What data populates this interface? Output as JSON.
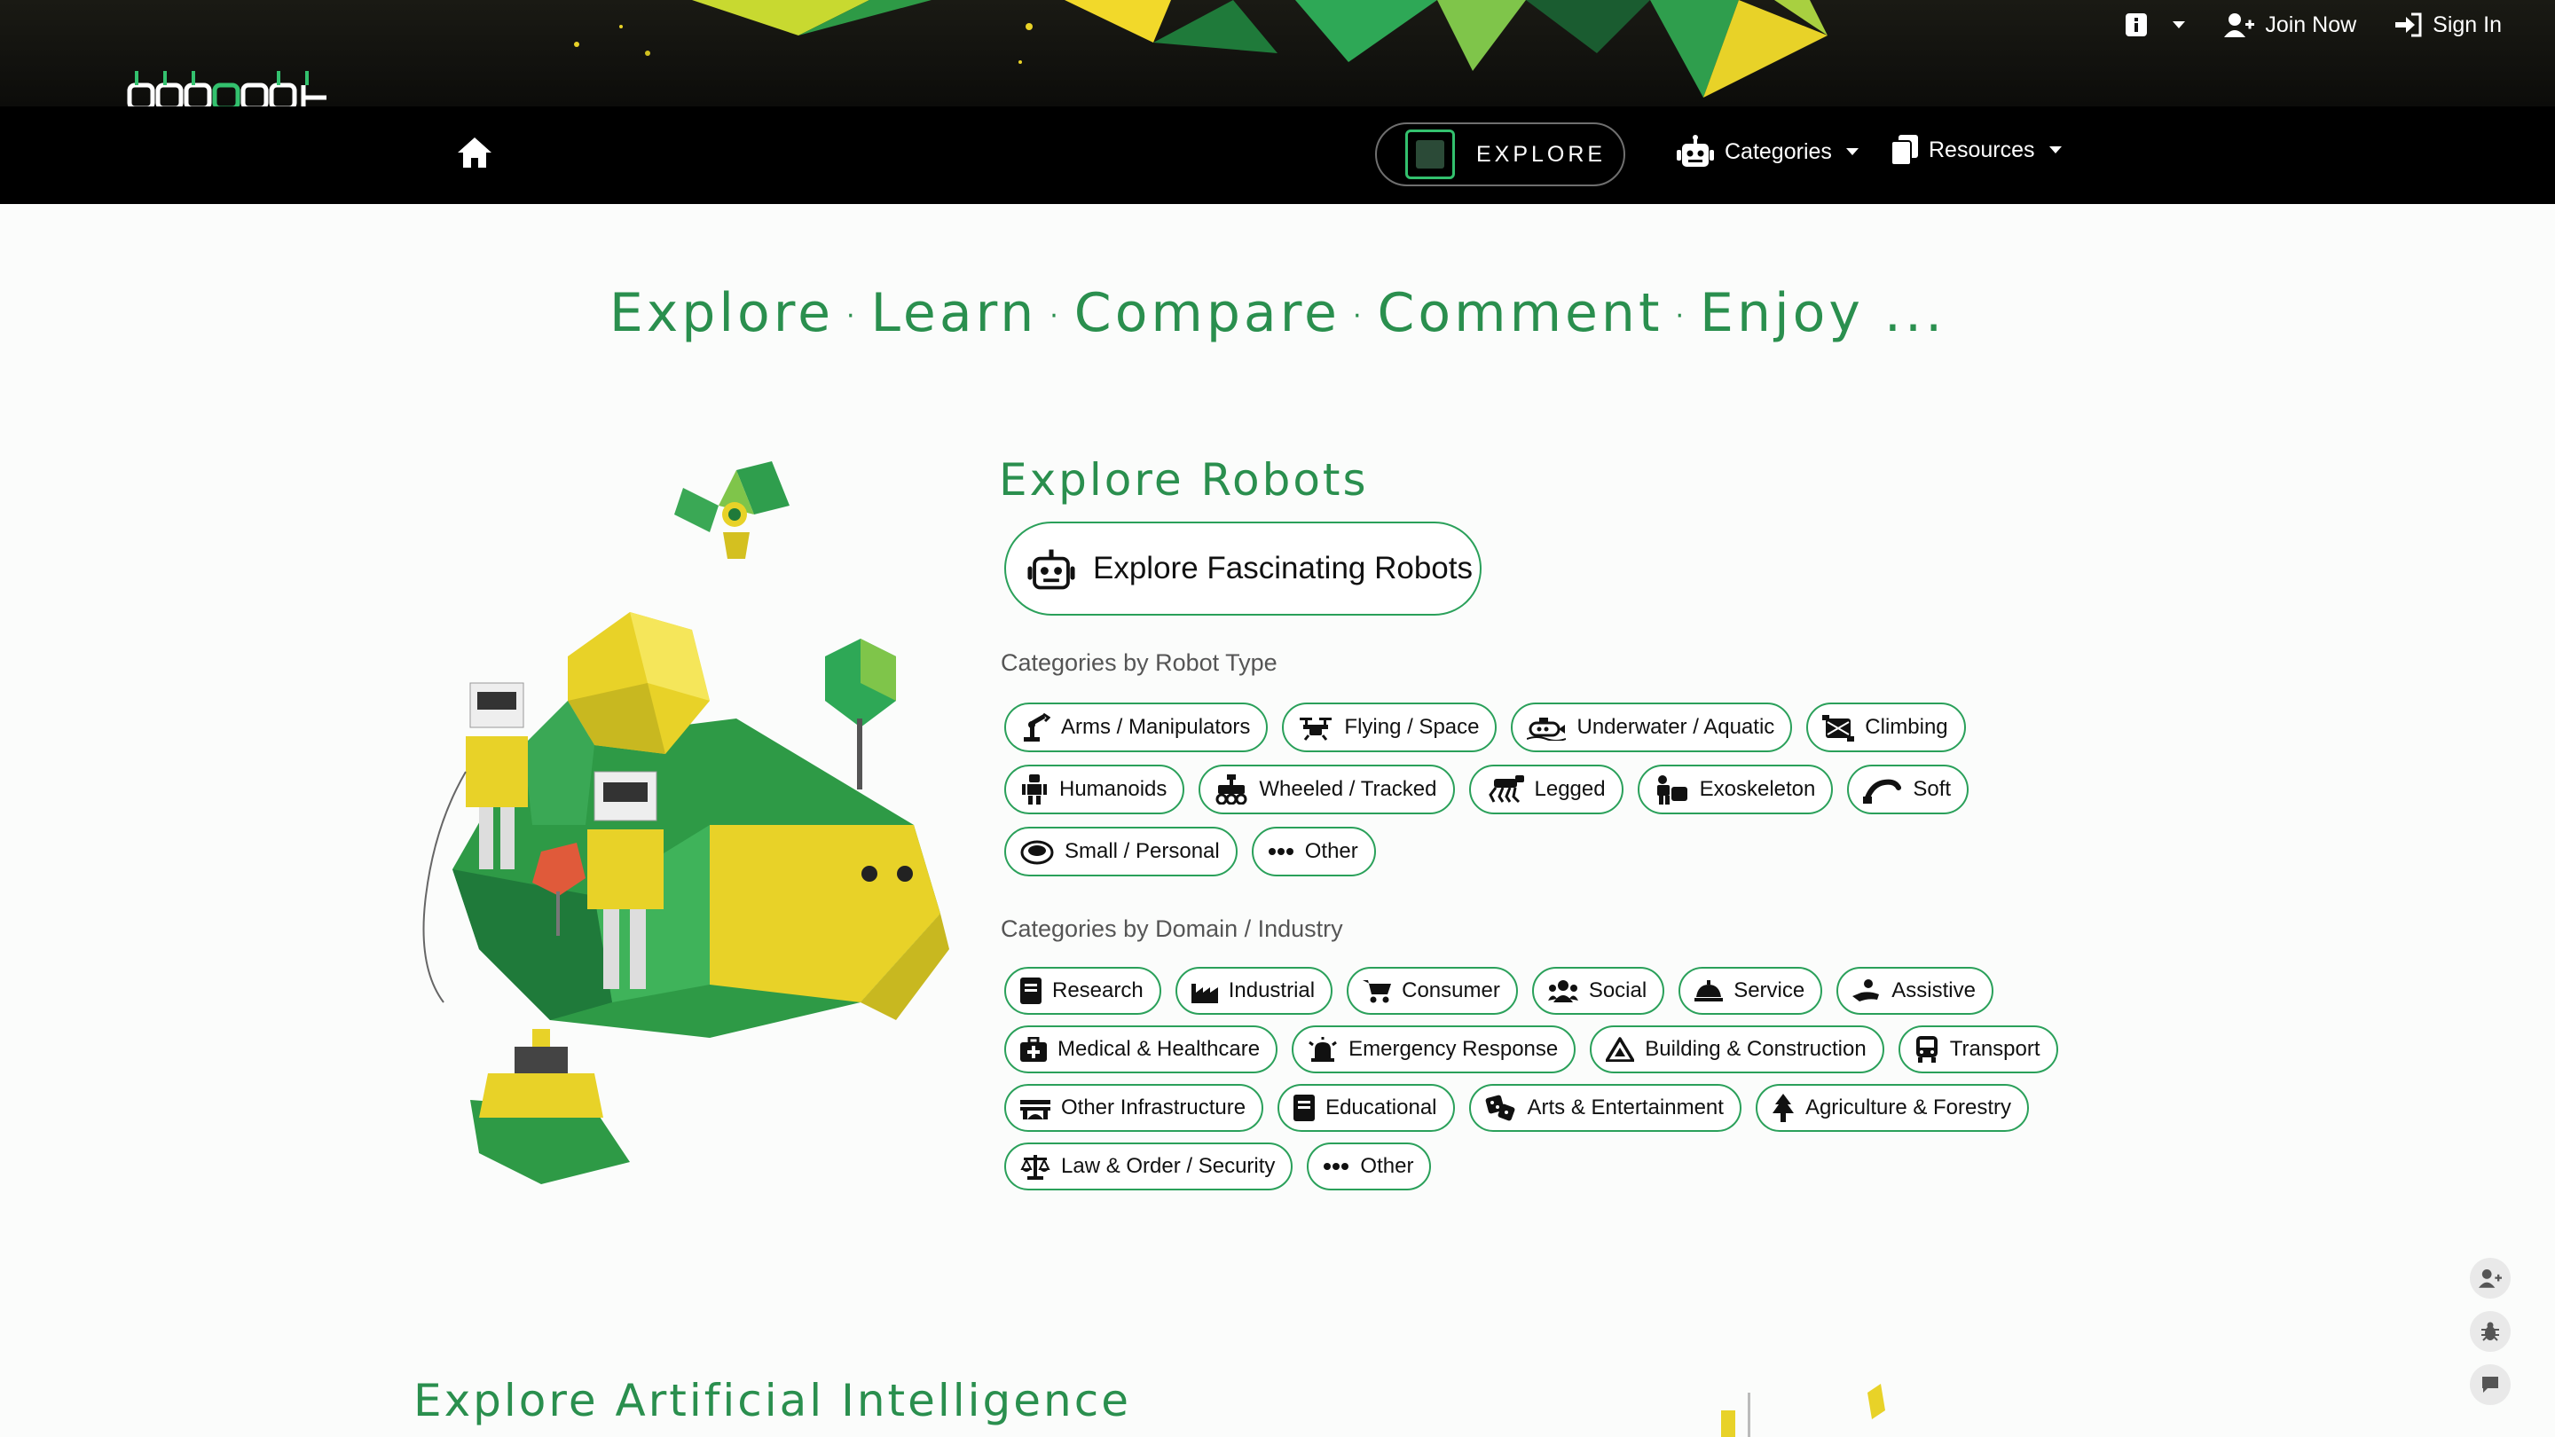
{
  "top_links": {
    "info_label": "",
    "join_label": "Join Now",
    "signin_label": "Sign In"
  },
  "logo": {
    "text": "roboroot"
  },
  "nav": {
    "explore_label": "EXPLORE",
    "categories_label": "Categories",
    "resources_label": "Resources"
  },
  "hero": {
    "tagline": [
      "Explore",
      "Learn",
      "Compare",
      "Comment",
      "Enjoy ..."
    ]
  },
  "explore_robots": {
    "title": "Explore Robots",
    "button_label": "Explore Fascinating Robots",
    "robot_type_heading": "Categories by Robot Type",
    "robot_types": [
      [
        "Arms / Manipulators",
        "Flying / Space",
        "Underwater / Aquatic",
        "Climbing"
      ],
      [
        "Humanoids",
        "Wheeled / Tracked",
        "Legged",
        "Exoskeleton",
        "Soft"
      ],
      [
        "Small / Personal",
        "Other"
      ]
    ],
    "domain_heading": "Categories by Domain / Industry",
    "domains": [
      [
        "Research",
        "Industrial",
        "Consumer",
        "Social",
        "Service",
        "Assistive"
      ],
      [
        "Medical & Healthcare",
        "Emergency Response",
        "Building & Construction",
        "Transport"
      ],
      [
        "Other Infrastructure",
        "Educational",
        "Arts & Entertainment",
        "Agriculture & Forestry"
      ],
      [
        "Law & Order / Security",
        "Other"
      ]
    ]
  },
  "explore_ai": {
    "title": "Explore Artificial Intelligence"
  },
  "colors": {
    "accent": "#2aa05a",
    "title_green": "#2a8f4e",
    "nav_bg": "#000000"
  }
}
